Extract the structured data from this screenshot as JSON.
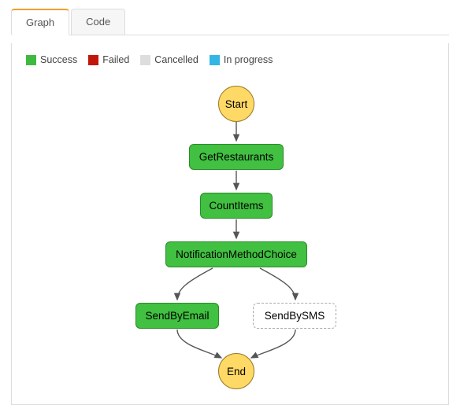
{
  "tabs": {
    "graph": "Graph",
    "code": "Code"
  },
  "legend": {
    "success": "Success",
    "failed": "Failed",
    "cancelled": "Cancelled",
    "inprogress": "In progress"
  },
  "nodes": {
    "start": "Start",
    "getRestaurants": "GetRestaurants",
    "countItems": "CountItems",
    "notificationMethodChoice": "NotificationMethodChoice",
    "sendByEmail": "SendByEmail",
    "sendBySMS": "SendBySMS",
    "end": "End"
  },
  "chart_data": {
    "type": "diagram",
    "flow": "state-machine",
    "title": "",
    "legend": [
      {
        "name": "Success",
        "color": "#41c041"
      },
      {
        "name": "Failed",
        "color": "#c2160a"
      },
      {
        "name": "Cancelled",
        "color": "#dddddd"
      },
      {
        "name": "In progress",
        "color": "#32b6e6"
      }
    ],
    "nodes": [
      {
        "id": "Start",
        "type": "start",
        "status": "terminal"
      },
      {
        "id": "GetRestaurants",
        "type": "task",
        "status": "Success"
      },
      {
        "id": "CountItems",
        "type": "task",
        "status": "Success"
      },
      {
        "id": "NotificationMethodChoice",
        "type": "choice",
        "status": "Success"
      },
      {
        "id": "SendByEmail",
        "type": "task",
        "status": "Success"
      },
      {
        "id": "SendBySMS",
        "type": "task",
        "status": "NotRun"
      },
      {
        "id": "End",
        "type": "end",
        "status": "terminal"
      }
    ],
    "edges": [
      {
        "from": "Start",
        "to": "GetRestaurants"
      },
      {
        "from": "GetRestaurants",
        "to": "CountItems"
      },
      {
        "from": "CountItems",
        "to": "NotificationMethodChoice"
      },
      {
        "from": "NotificationMethodChoice",
        "to": "SendByEmail"
      },
      {
        "from": "NotificationMethodChoice",
        "to": "SendBySMS"
      },
      {
        "from": "SendByEmail",
        "to": "End"
      },
      {
        "from": "SendBySMS",
        "to": "End"
      }
    ]
  }
}
